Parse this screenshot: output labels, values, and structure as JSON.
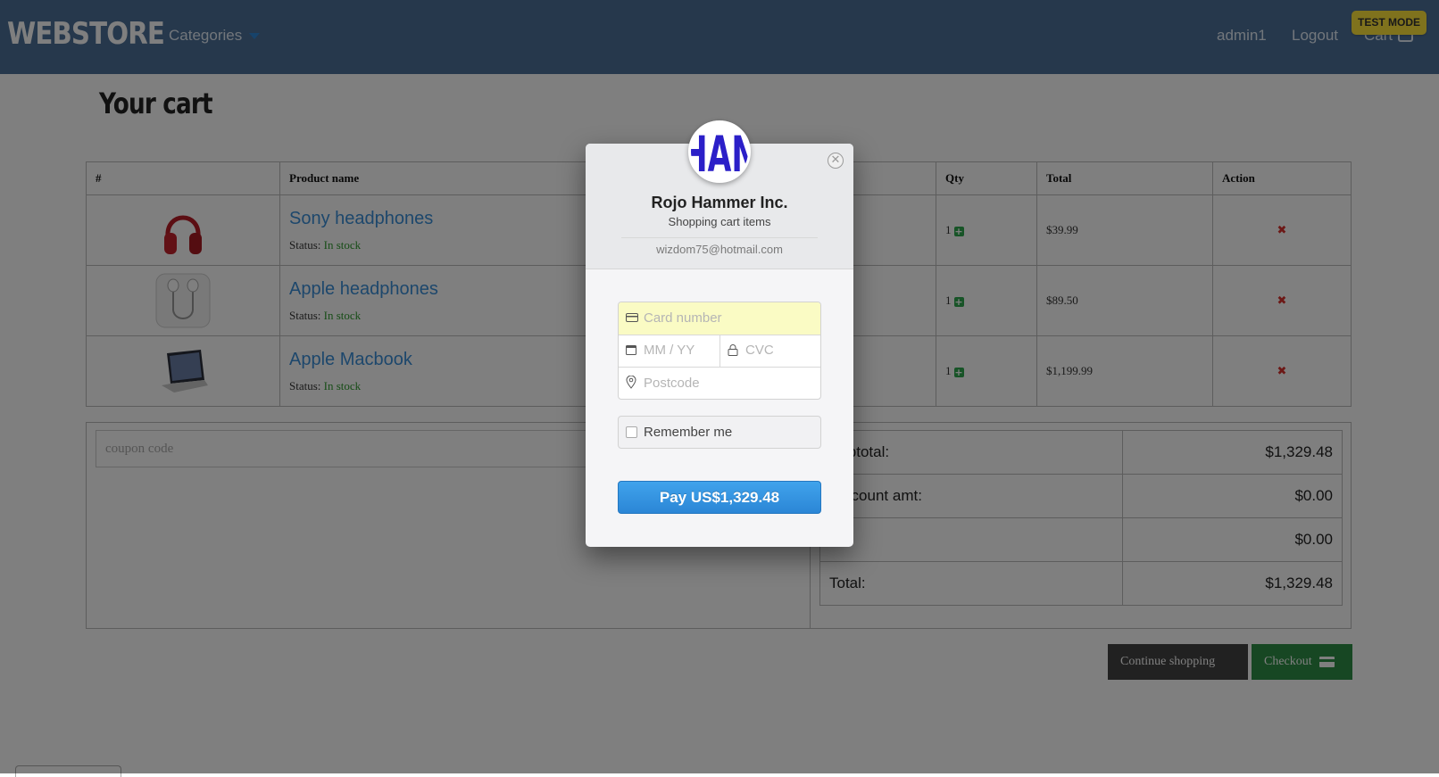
{
  "navbar": {
    "brand": "WEBSTORE",
    "categories": "Categories",
    "user": "admin1",
    "logout": "Logout",
    "cart": "Cart",
    "test_mode": "TEST MODE"
  },
  "page_title": "Your cart",
  "table": {
    "headers": [
      "#",
      "Product name",
      "Qty",
      "Total",
      "Action"
    ],
    "status_label": "Status:",
    "rows": [
      {
        "name": "Sony headphones",
        "status": "In stock",
        "qty": "1",
        "total": "$39.99"
      },
      {
        "name": "Apple headphones",
        "status": "In stock",
        "qty": "1",
        "total": "$89.50"
      },
      {
        "name": "Apple Macbook",
        "status": "In stock",
        "qty": "1",
        "total": "$1,199.99"
      }
    ]
  },
  "coupon": {
    "placeholder": "coupon code"
  },
  "totals": {
    "rows": [
      {
        "label": "Subtotal:",
        "value": "$1,329.48"
      },
      {
        "label": "Discount amt:",
        "value": "$0.00"
      },
      {
        "label": "",
        "value": "$0.00"
      },
      {
        "label": "Total:",
        "value": "$1,329.48"
      }
    ]
  },
  "buttons": {
    "continue": "Continue shopping",
    "checkout": "Checkout"
  },
  "modal": {
    "logo_text": "HAN",
    "merchant": "Rojo Hammer Inc.",
    "description": "Shopping cart items",
    "email": "wizdom75@hotmail.com",
    "card_placeholder": "Card number",
    "exp_placeholder": "MM / YY",
    "cvc_placeholder": "CVC",
    "postcode_placeholder": "Postcode",
    "remember": "Remember me",
    "pay": "Pay US$1,329.48"
  },
  "colors": {
    "navbar": "#4d7099",
    "link": "#3a8fd8",
    "in_stock": "#2f9a2f",
    "checkout": "#2f8f46",
    "pay_button": "#2b86d6",
    "test_mode": "#ffe53b"
  }
}
